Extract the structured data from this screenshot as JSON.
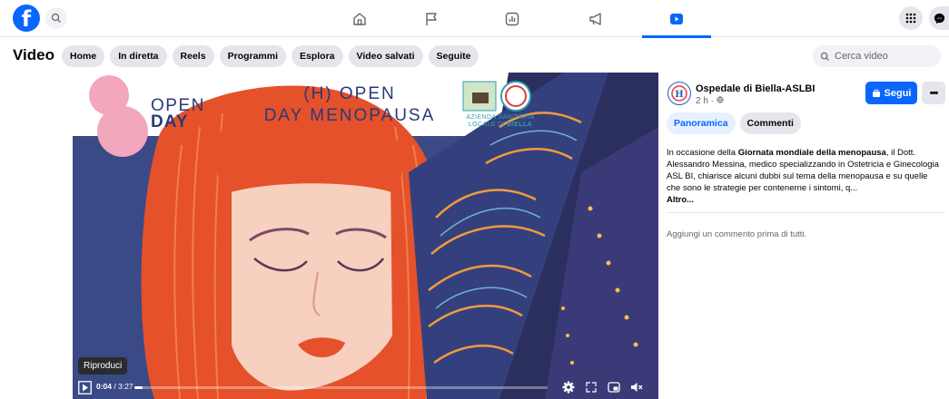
{
  "topbar": {
    "logo": "f",
    "icons": [
      "home-icon",
      "flag-icon",
      "stats-icon",
      "megaphone-icon",
      "video-icon"
    ],
    "active_icon": "video-icon",
    "accent": "#0866ff"
  },
  "subheader": {
    "title": "Video",
    "pills": [
      "Home",
      "In diretta",
      "Reels",
      "Programmi",
      "Esplora",
      "Video salvati",
      "Seguite"
    ],
    "search_placeholder": "Cerca video"
  },
  "video": {
    "title_line1": "(H) OPEN",
    "title_line2": "DAY MENOPAUSA",
    "logo_open": "OPEN",
    "logo_day": "DAY",
    "asl_line1": "AZIENDA SANITARIA",
    "asl_line2_pre": "LOCALE DI ",
    "asl_line2_bold": "BIELLA",
    "tooltip": "Riproduci",
    "time_current": "0:04",
    "time_total": "3:27",
    "progress_fraction": 0.02
  },
  "post": {
    "page_name": "Ospedale di Biella-ASLBI",
    "meta": "2 h · ",
    "follow_label": "Segui",
    "tabs": [
      "Panoramica",
      "Commenti"
    ],
    "active_tab": "Panoramica",
    "desc_pre": "In occasione della ",
    "desc_bold": "Giornata mondiale della menopausa",
    "desc_post": ", il Dott. Alessandro Messina, medico specializzando in Ostetricia e Ginecologia ASL BI, chiarisce alcuni dubbi sul tema della menopausa e su quelle che sono le strategie per contenerne i sintomi, q...",
    "more_link": "Altro...",
    "comment_prompt": "Aggiungi un commento prima di tutti."
  }
}
